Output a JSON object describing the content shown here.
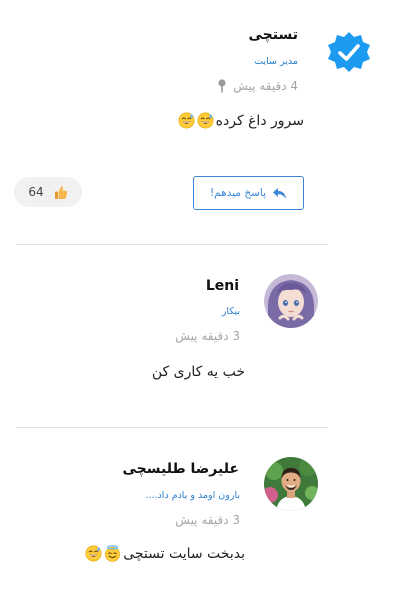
{
  "comments": [
    {
      "author": "تستچی",
      "role": "مدیر سایت",
      "time": "4 دقیقه پیش",
      "text": "سرور داغ کرده",
      "emojis": [
        "grinning-sweat",
        "grinning-sweat"
      ],
      "verified": true,
      "reply_label": "پاسخ میدهم!",
      "likes": "64"
    },
    {
      "author": "Leni",
      "role": "بیکار",
      "time": "3 دقیقه پیش",
      "text": "خب یه کاری کن",
      "emojis": []
    },
    {
      "author": "علیرضا طلیسچی",
      "role": "بارون اومد و یادم داد....",
      "time": "3 دقیقه پیش",
      "text": "بدبخت سایت تستچی",
      "emojis": [
        "smiling-halo",
        "grinning-sweat"
      ]
    }
  ],
  "icons": {
    "verified": "verified-badge-icon",
    "pin": "pin-icon",
    "reply": "reply-arrow-icon",
    "like": "thumbs-up-icon"
  },
  "colors": {
    "accent": "#3a86d8",
    "verified": "#1d9bf0",
    "role": "#2a7fcf",
    "muted": "#a4a4a4"
  }
}
